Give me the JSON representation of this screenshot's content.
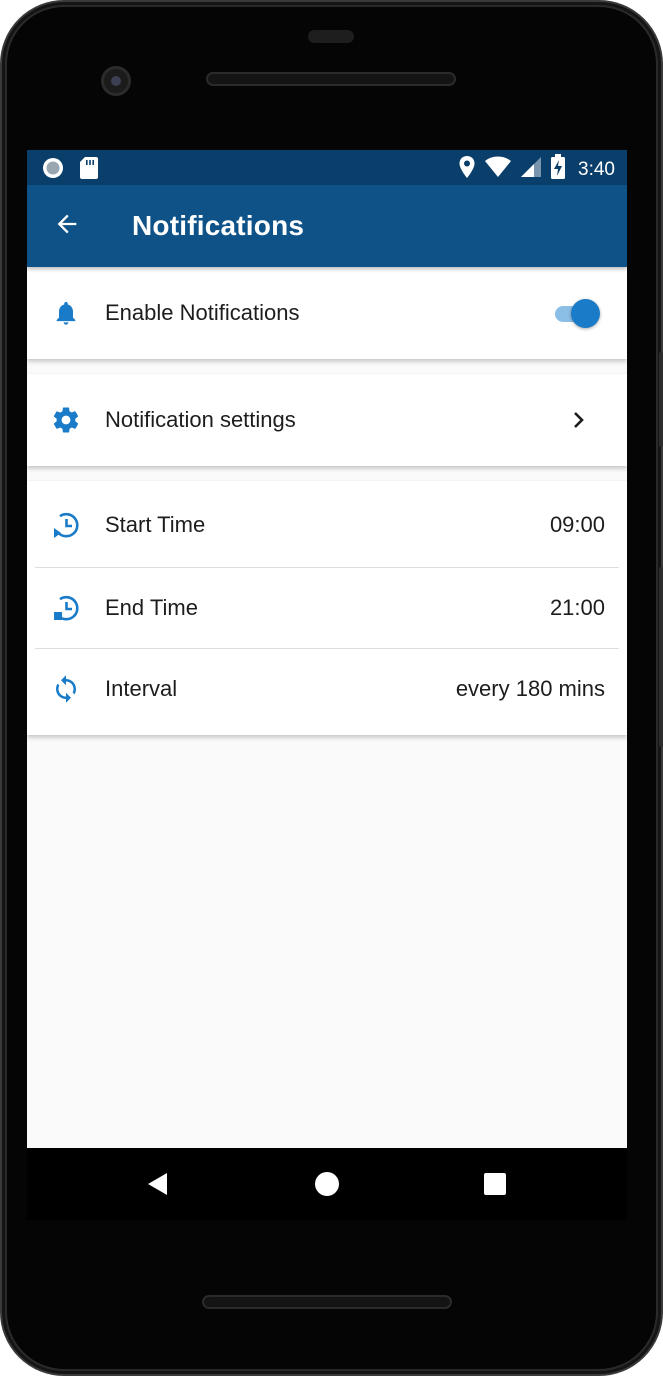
{
  "status_bar": {
    "time": "3:40",
    "left_icons": [
      "record-icon",
      "sd-card-icon"
    ],
    "right_icons": [
      "location-icon",
      "wifi-icon",
      "cell-signal-icon",
      "battery-charging-icon"
    ]
  },
  "app_bar": {
    "title": "Notifications",
    "back_icon": "arrow-back-icon"
  },
  "enable_card": {
    "label": "Enable Notifications",
    "icon": "bell-icon",
    "toggle_on": true
  },
  "settings_card": {
    "label": "Notification settings",
    "icon": "gear-icon",
    "chevron_icon": "chevron-right-icon"
  },
  "schedule_card": {
    "rows": [
      {
        "label": "Start Time",
        "value": "09:00",
        "icon": "clock-start-icon"
      },
      {
        "label": "End Time",
        "value": "21:00",
        "icon": "clock-end-icon"
      },
      {
        "label": "Interval",
        "value": "every 180 mins",
        "icon": "sync-icon"
      }
    ]
  },
  "nav_bar": {
    "icons": [
      "back-triangle-icon",
      "home-circle-icon",
      "recents-square-icon"
    ]
  },
  "colors": {
    "status_bar": "#0a3f6b",
    "app_bar": "#0e5287",
    "accent": "#1a7bc8",
    "background": "#fafafa"
  }
}
